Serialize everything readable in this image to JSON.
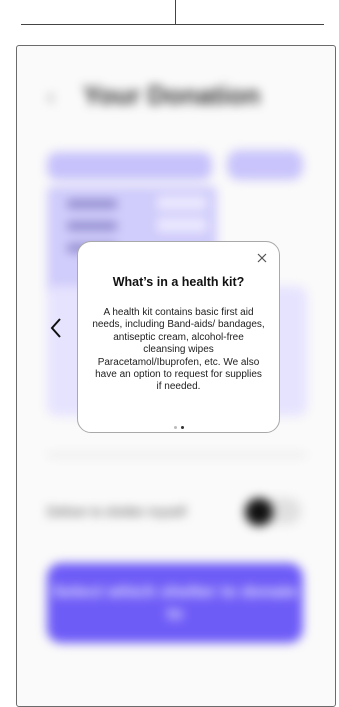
{
  "background": {
    "title": "Your Donation",
    "deliver_label": "Deliver to shelter myself",
    "cta_label": "Select which shelter to donate to"
  },
  "modal": {
    "title": "What’s in a health kit?",
    "body": "A health kit contains basic first aid needs, including Band-aids/ bandages, antiseptic cream, alcohol-free cleansing wipes Paracetamol/Ibuprofen, etc. We also have an option to request for supplies if needed.",
    "page_count": 2,
    "active_page": 2
  },
  "icons": {
    "close": "close-icon",
    "prev": "chevron-left-icon"
  },
  "colors": {
    "accent": "#6e5cf7",
    "accent_light": "#d0ccfb"
  }
}
